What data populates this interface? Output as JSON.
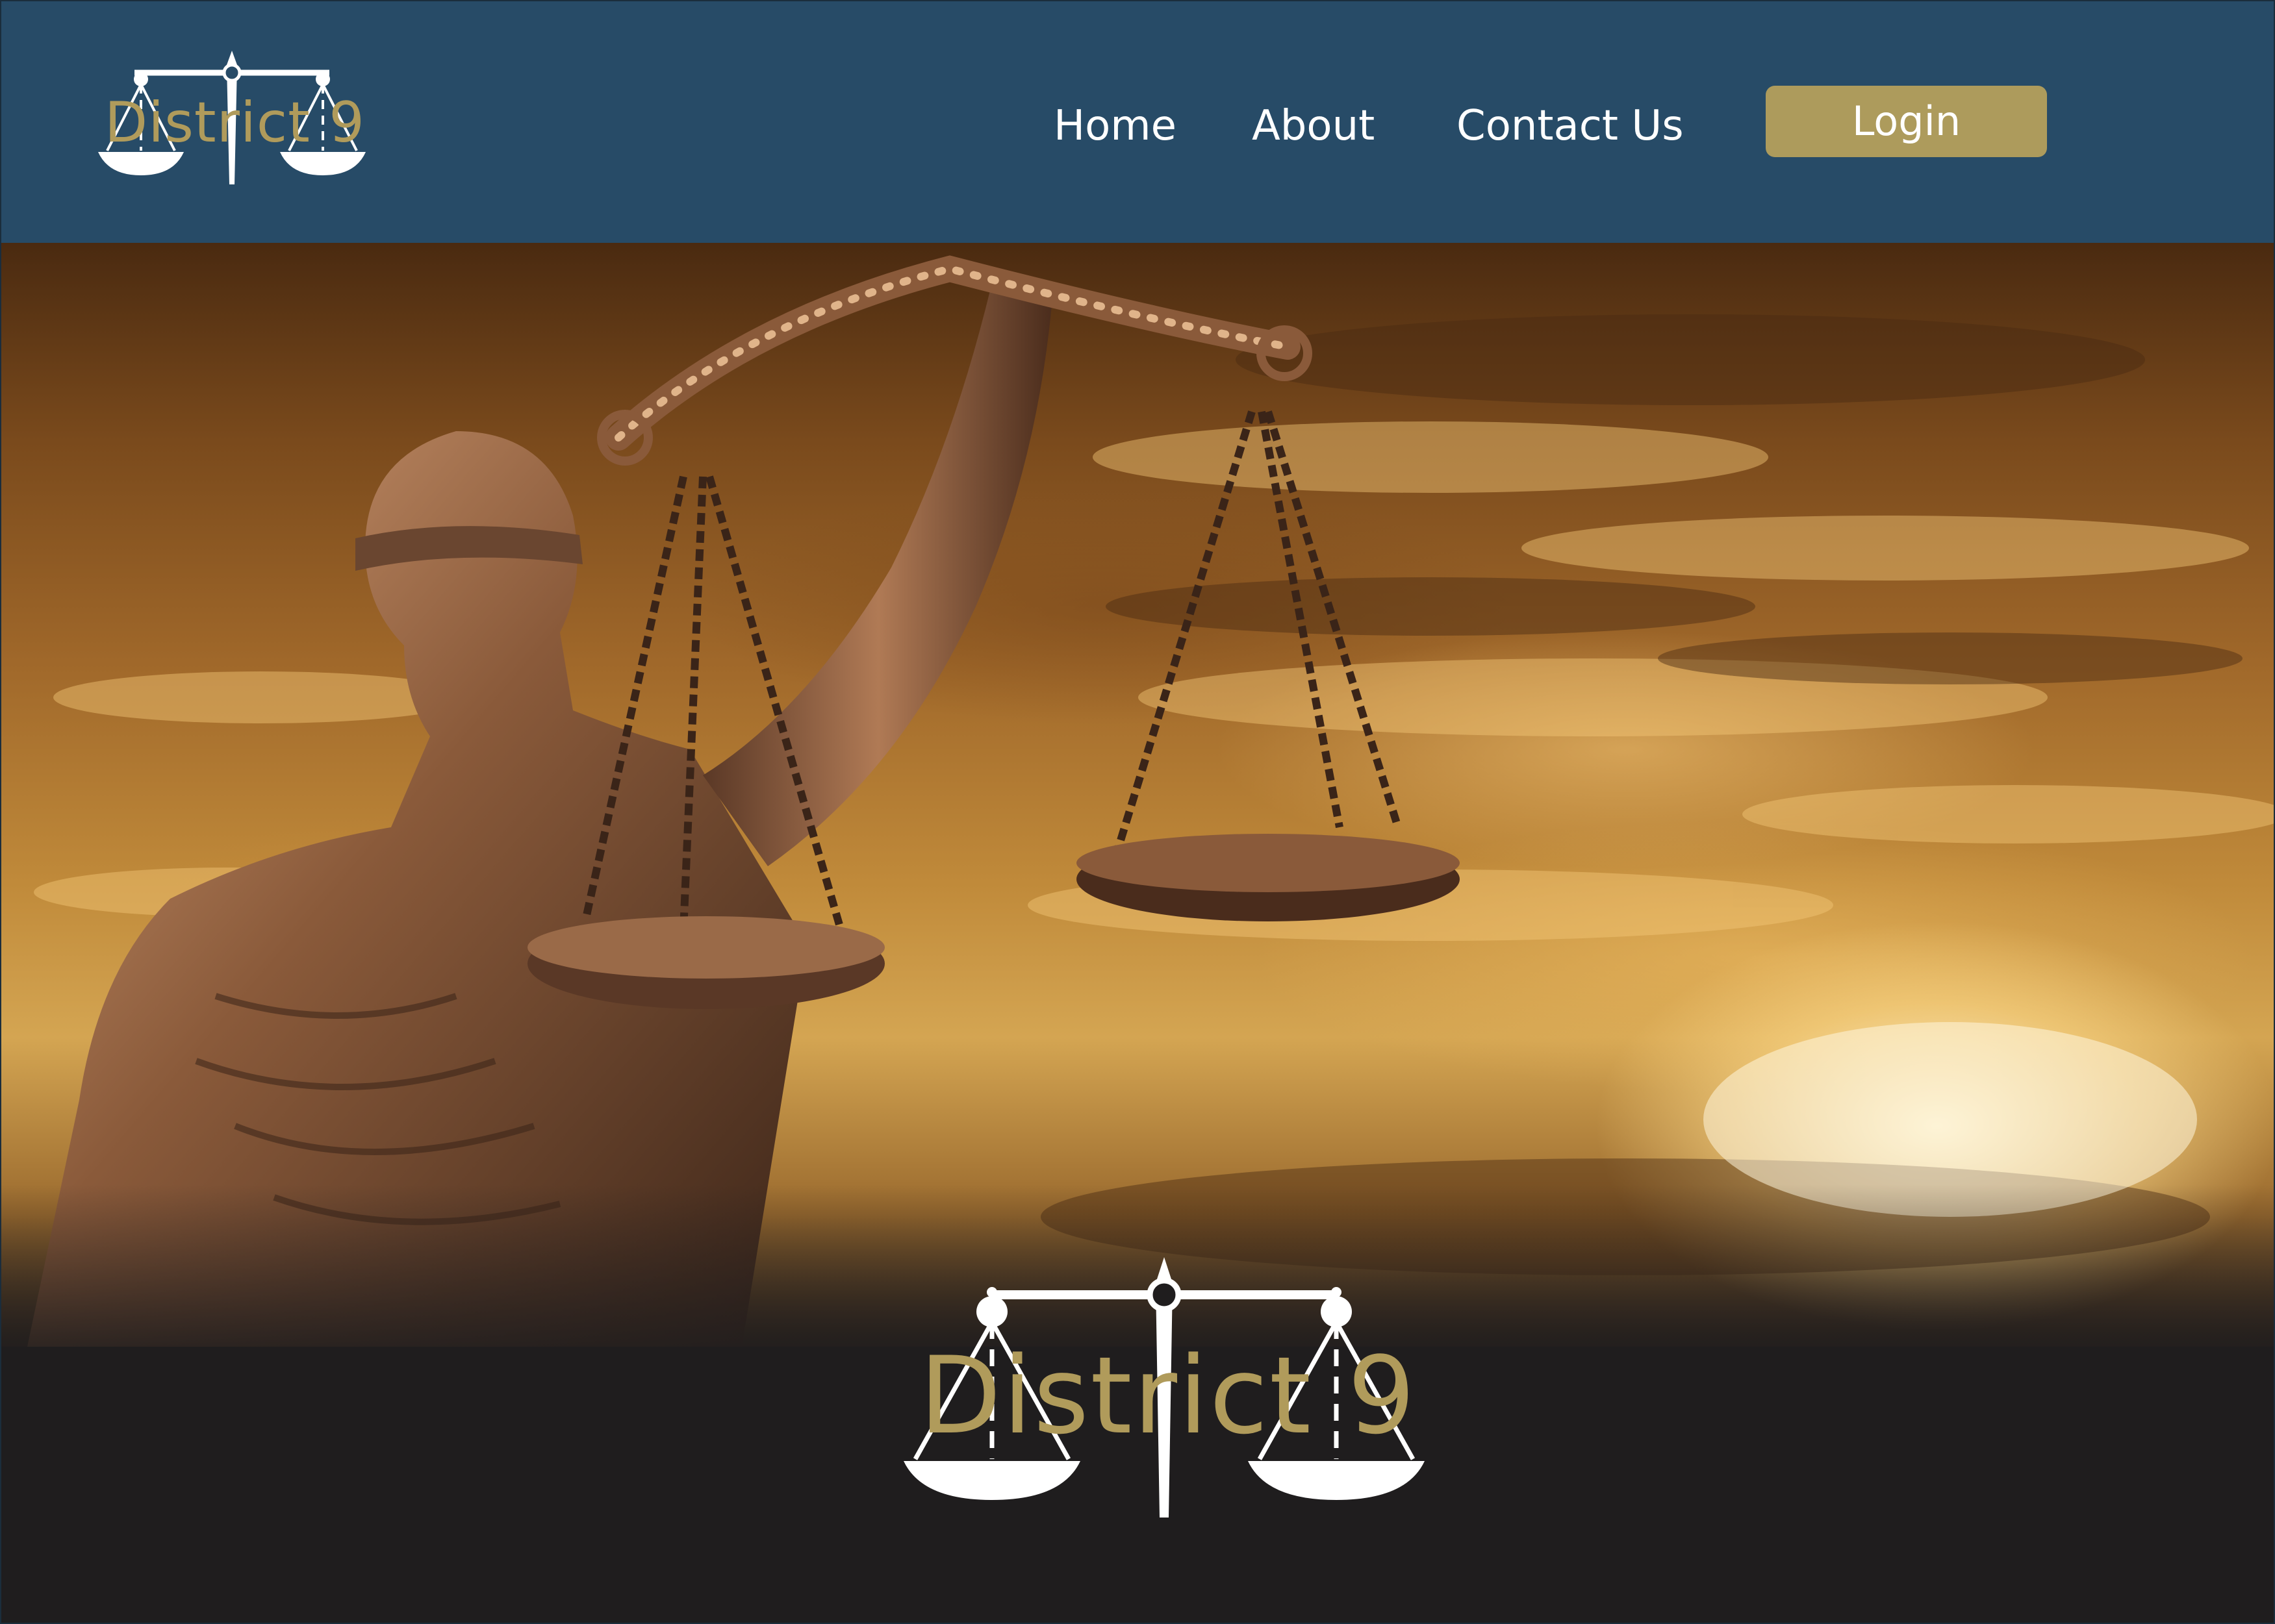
{
  "brand": {
    "name": "District 9",
    "logo_icon": "scales-of-justice-icon"
  },
  "nav": {
    "items": [
      {
        "label": "Home"
      },
      {
        "label": "About"
      },
      {
        "label": "Contact Us"
      }
    ],
    "login_label": "Login"
  },
  "hero": {
    "image": "lady-justice-statue-holding-scales-against-golden-sunset-sky"
  },
  "footer": {
    "logo_name": "District 9",
    "logo_icon": "scales-of-justice-icon"
  },
  "colors": {
    "header_bg": "#274b67",
    "accent_gold": "#ad9b5c",
    "footer_bg": "#1f1d1e",
    "text_white": "#ffffff"
  }
}
